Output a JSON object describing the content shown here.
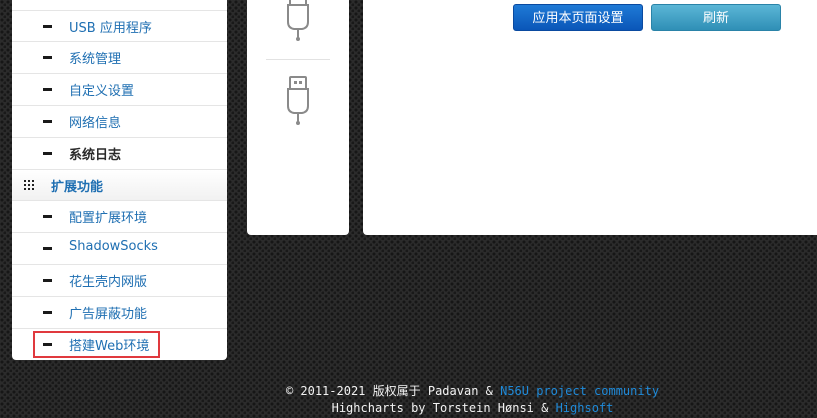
{
  "sidebar": {
    "items": [
      {
        "label": "USB 应用程序",
        "type": "item"
      },
      {
        "label": "系统管理",
        "type": "item"
      },
      {
        "label": "自定义设置",
        "type": "item"
      },
      {
        "label": "网络信息",
        "type": "item"
      },
      {
        "label": "系统日志",
        "type": "item",
        "active": true
      },
      {
        "label": "扩展功能",
        "type": "section"
      },
      {
        "label": "配置扩展环境",
        "type": "item"
      },
      {
        "label": "ShadowSocks",
        "type": "item"
      },
      {
        "label": "花生壳内网版",
        "type": "item"
      },
      {
        "label": "广告屏蔽功能",
        "type": "item"
      },
      {
        "label": "搭建Web环境",
        "type": "item",
        "highlighted": true
      }
    ]
  },
  "usb_panel": {
    "icons": [
      "usb-icon",
      "usb-icon"
    ]
  },
  "main": {
    "apply_button": "应用本页面设置",
    "refresh_button": "刷新"
  },
  "footer": {
    "copyright": "© 2011-2021 版权属于 Padavan & ",
    "community_link": "N56U project community",
    "charts_text": "Highcharts by Torstein Hønsi & ",
    "highsoft_link": "Highsoft"
  },
  "colors": {
    "link": "#1f6fb2",
    "primary_button": "#0a56b8",
    "info_button": "#2f8fb6",
    "highlight_border": "#e0393e"
  }
}
